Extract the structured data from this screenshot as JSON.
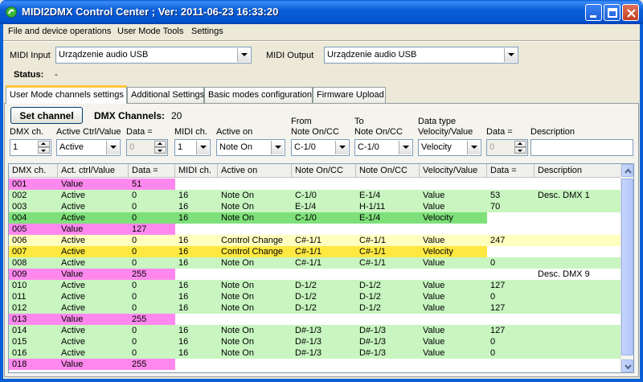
{
  "window": {
    "title": "MIDI2DMX Control Center ; Ver: 2011-06-23 16:33:20"
  },
  "menu": [
    "File and device operations",
    "User Mode Tools",
    "Settings"
  ],
  "midi_input": {
    "label": "MIDI Input",
    "value": "Urządzenie audio USB"
  },
  "midi_output": {
    "label": "MIDI Output",
    "value": "Urządzenie audio USB"
  },
  "status": {
    "label": "Status:",
    "value": "-"
  },
  "tabs": [
    "User Mode channels settings",
    "Additional Settings",
    "Basic modes configuration",
    "Firmware Upload"
  ],
  "controls": {
    "set_channel_label": "Set channel",
    "dmx_channels_label": "DMX Channels:",
    "dmx_channels_value": "20",
    "dmx_ch_label": "DMX ch.",
    "dmx_ch_value": "1",
    "active_label": "Active Ctrl/Value",
    "active_value": "Active",
    "data_label": "Data =",
    "data_value": "0",
    "midi_ch_label": "MIDI ch.",
    "midi_ch_value": "1",
    "active_on_label": "Active on",
    "active_on_value": "Note On",
    "from_label_1": "From",
    "from_label_2": "Note On/CC",
    "from_value": "C-1/0",
    "to_label_1": "To",
    "to_label_2": "Note On/CC",
    "to_value": "C-1/0",
    "dtype_label_1": "Data type",
    "dtype_label_2": "Velocity/Value",
    "dtype_value": "Velocity",
    "data2_label": "Data =",
    "data2_value": "0",
    "desc_label": "Description",
    "desc_value": ""
  },
  "grid": {
    "headers": [
      "DMX ch.",
      "Act. ctrl/Value",
      "Data =",
      "MIDI ch.",
      "Active on",
      "Note On/CC",
      "Note On/CC",
      "Velocity/Value",
      "Data =",
      "Description"
    ],
    "rows": [
      {
        "c": [
          "001",
          "Value",
          "51",
          "",
          "",
          "",
          "",
          "",
          "",
          ""
        ],
        "color": "pink"
      },
      {
        "c": [
          "002",
          "Active",
          "0",
          "16",
          "Note On",
          "C-1/0",
          "E-1/4",
          "Value",
          "53",
          "Desc. DMX 1"
        ],
        "color": "lightgreen"
      },
      {
        "c": [
          "003",
          "Active",
          "0",
          "16",
          "Note On",
          "E-1/4",
          "H-1/11",
          "Value",
          "70",
          ""
        ],
        "color": "lightgreen"
      },
      {
        "c": [
          "004",
          "Active",
          "0",
          "16",
          "Note On",
          "C-1/0",
          "E-1/4",
          "Velocity",
          "",
          ""
        ],
        "color": "green"
      },
      {
        "c": [
          "005",
          "Value",
          "127",
          "",
          "",
          "",
          "",
          "",
          "",
          ""
        ],
        "color": "pink"
      },
      {
        "c": [
          "006",
          "Active",
          "0",
          "16",
          "Control Change",
          "C#-1/1",
          "C#-1/1",
          "Value",
          "247",
          ""
        ],
        "color": "lightyellow"
      },
      {
        "c": [
          "007",
          "Active",
          "0",
          "16",
          "Control Change",
          "C#-1/1",
          "C#-1/1",
          "Velocity",
          "",
          ""
        ],
        "color": "yellow"
      },
      {
        "c": [
          "008",
          "Active",
          "0",
          "16",
          "Note On",
          "C#-1/1",
          "C#-1/1",
          "Value",
          "0",
          ""
        ],
        "color": "lightgreen"
      },
      {
        "c": [
          "009",
          "Value",
          "255",
          "",
          "",
          "",
          "",
          "",
          "",
          "Desc. DMX 9"
        ],
        "color": "pink"
      },
      {
        "c": [
          "010",
          "Active",
          "0",
          "16",
          "Note On",
          "D-1/2",
          "D-1/2",
          "Value",
          "127",
          ""
        ],
        "color": "lightgreen"
      },
      {
        "c": [
          "011",
          "Active",
          "0",
          "16",
          "Note On",
          "D-1/2",
          "D-1/2",
          "Value",
          "0",
          ""
        ],
        "color": "lightgreen"
      },
      {
        "c": [
          "012",
          "Active",
          "0",
          "16",
          "Note On",
          "D-1/2",
          "D-1/2",
          "Value",
          "127",
          ""
        ],
        "color": "lightgreen"
      },
      {
        "c": [
          "013",
          "Value",
          "255",
          "",
          "",
          "",
          "",
          "",
          "",
          ""
        ],
        "color": "pink"
      },
      {
        "c": [
          "014",
          "Active",
          "0",
          "16",
          "Note On",
          "D#-1/3",
          "D#-1/3",
          "Value",
          "127",
          ""
        ],
        "color": "lightgreen"
      },
      {
        "c": [
          "015",
          "Active",
          "0",
          "16",
          "Note On",
          "D#-1/3",
          "D#-1/3",
          "Value",
          "0",
          ""
        ],
        "color": "lightgreen"
      },
      {
        "c": [
          "016",
          "Active",
          "0",
          "16",
          "Note On",
          "D#-1/3",
          "D#-1/3",
          "Value",
          "0",
          ""
        ],
        "color": "lightgreen"
      },
      {
        "c": [
          "018",
          "Value",
          "255",
          "",
          "",
          "",
          "",
          "",
          "",
          ""
        ],
        "color": "pink"
      }
    ]
  },
  "colors": {
    "pink": "#ff88ee",
    "lightgreen": "#c8f5c0",
    "green": "#7ee07a",
    "lightyellow": "#ffffc0",
    "yellow": "#ffe840",
    "white": "#ffffff"
  }
}
